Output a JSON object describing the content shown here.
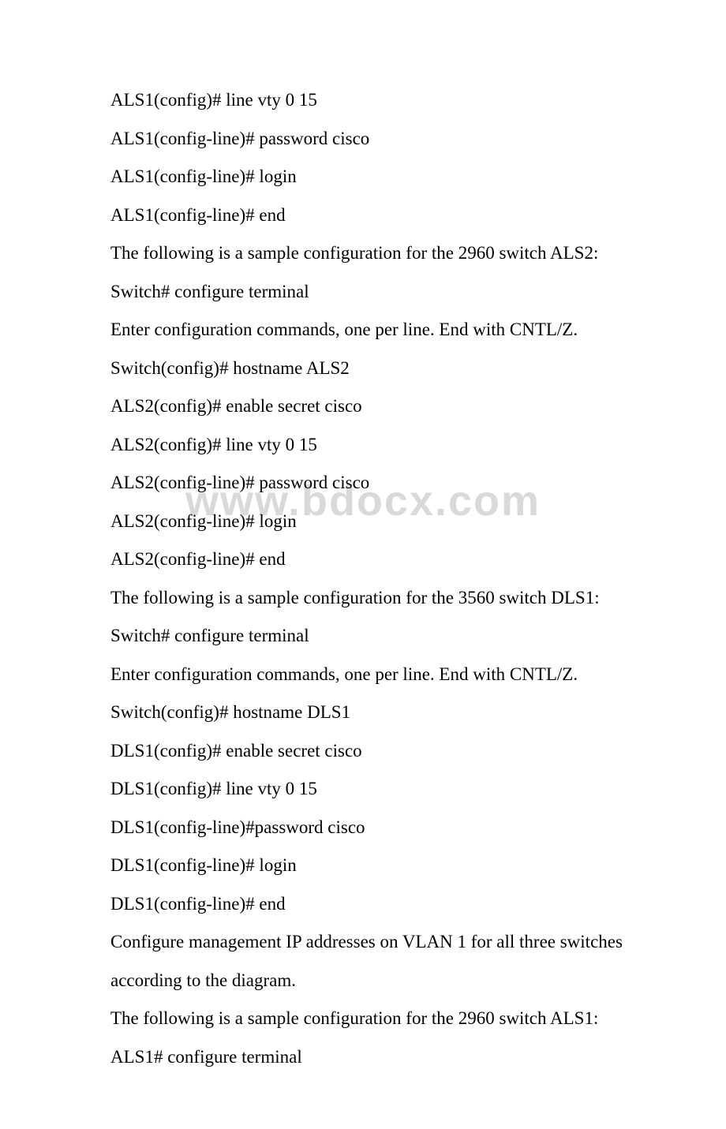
{
  "watermark": "www.bdocx.com",
  "lines": [
    "ALS1(config)# line vty 0 15",
    "ALS1(config-line)# password cisco",
    "ALS1(config-line)# login",
    "ALS1(config-line)# end",
    "The following is a sample configuration for the 2960 switch ALS2:",
    "Switch# configure terminal",
    "Enter configuration commands, one per line. End with CNTL/Z.",
    "Switch(config)# hostname ALS2",
    "ALS2(config)# enable secret cisco",
    "ALS2(config)# line vty 0 15",
    "ALS2(config-line)# password cisco",
    "ALS2(config-line)# login",
    "ALS2(config-line)# end",
    "The following is a sample configuration for the 3560 switch DLS1:",
    "Switch# configure terminal",
    "Enter configuration commands, one per line. End with CNTL/Z.",
    "Switch(config)# hostname DLS1",
    "DLS1(config)# enable secret cisco",
    "DLS1(config)# line vty 0 15",
    "DLS1(config-line)#password cisco",
    "DLS1(config-line)# login",
    "DLS1(config-line)# end",
    "Configure management IP addresses on VLAN 1 for all three switches",
    "according to the diagram.",
    "The following is a sample configuration for the 2960 switch ALS1:",
    "ALS1# configure terminal"
  ]
}
